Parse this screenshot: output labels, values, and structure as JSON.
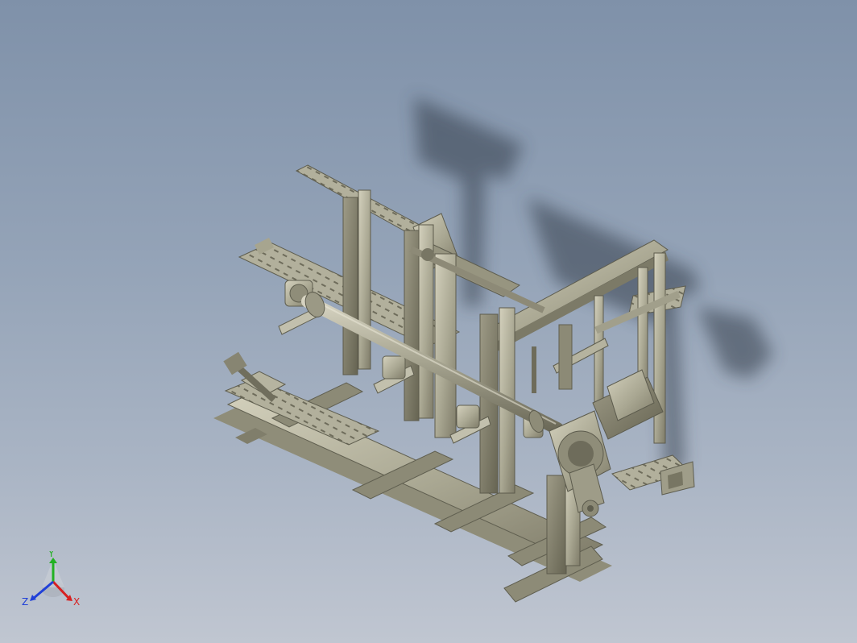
{
  "viewport": {
    "background_top": "#7f91a9",
    "background_bottom": "#c0c6d1"
  },
  "model": {
    "material_color": "#a9a792",
    "shadow_color": "#2f3945"
  },
  "triad": {
    "x_label": "X",
    "y_label": "Y",
    "z_label": "Z",
    "x_color": "#d72020",
    "y_color": "#22b122",
    "z_color": "#2040d8"
  }
}
